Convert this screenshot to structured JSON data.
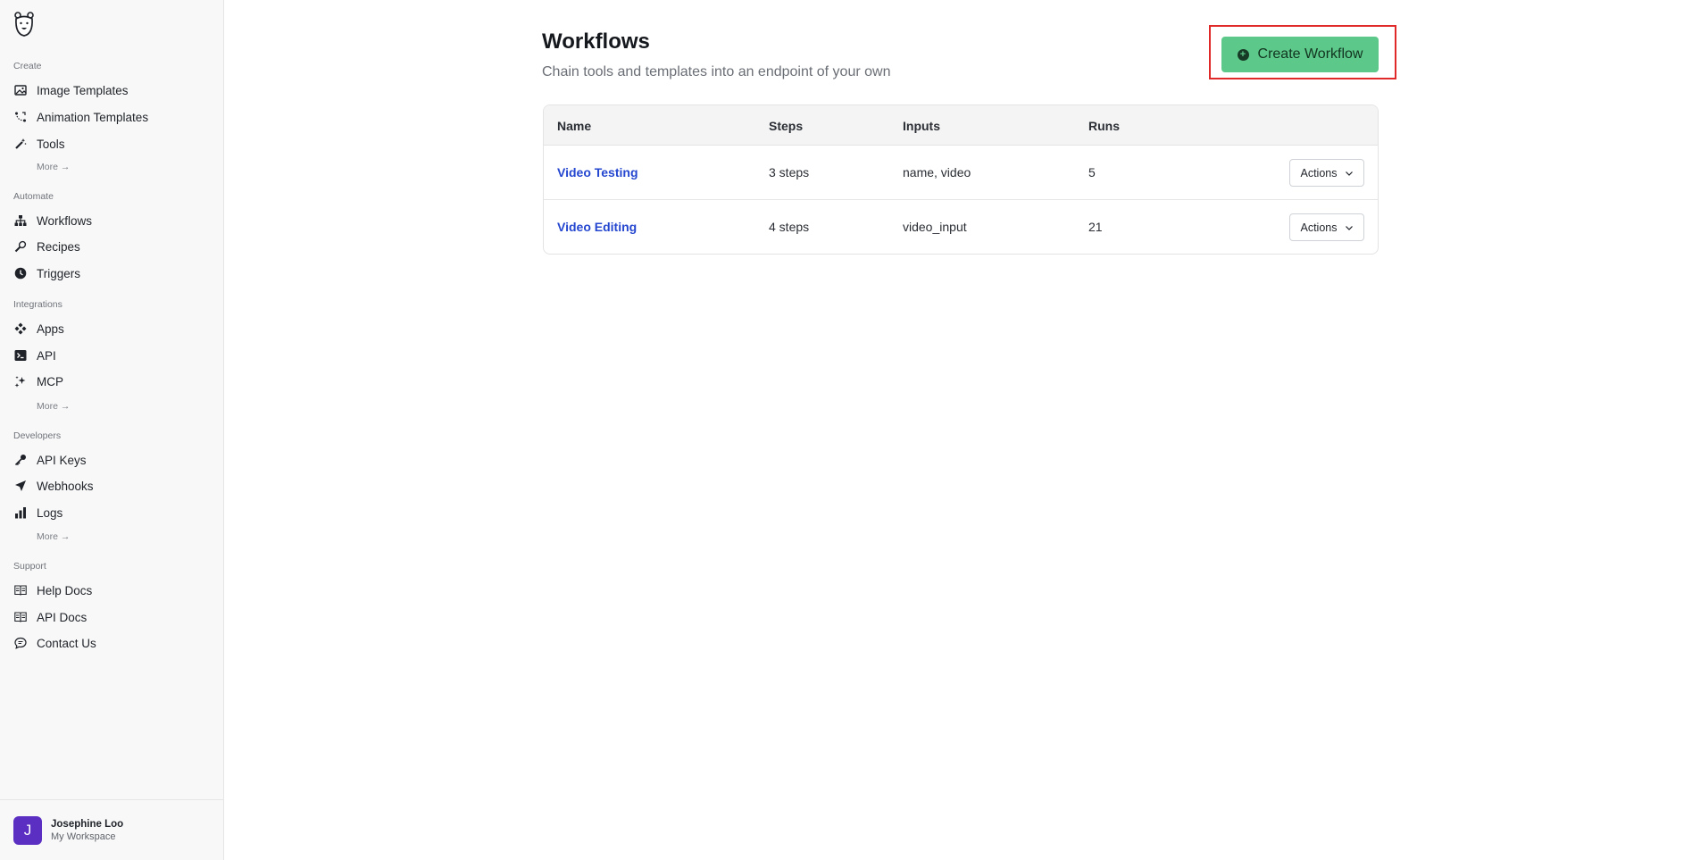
{
  "sidebar": {
    "sections": {
      "create": "Create",
      "automate": "Automate",
      "integrations": "Integrations",
      "developers": "Developers",
      "support": "Support"
    },
    "items": {
      "image_templates": "Image Templates",
      "animation_templates": "Animation Templates",
      "tools": "Tools",
      "workflows": "Workflows",
      "recipes": "Recipes",
      "triggers": "Triggers",
      "apps": "Apps",
      "api": "API",
      "mcp": "MCP",
      "api_keys": "API Keys",
      "webhooks": "Webhooks",
      "logs": "Logs",
      "help_docs": "Help Docs",
      "api_docs": "API Docs",
      "contact_us": "Contact Us"
    },
    "more_label": "More →",
    "user": {
      "initial": "J",
      "name": "Josephine Loo",
      "workspace": "My Workspace"
    }
  },
  "main": {
    "title": "Workflows",
    "subtitle": "Chain tools and templates into an endpoint of your own",
    "create_button": "Create Workflow",
    "table": {
      "headers": {
        "name": "Name",
        "steps": "Steps",
        "inputs": "Inputs",
        "runs": "Runs"
      },
      "rows": [
        {
          "name": "Video Testing",
          "steps": "3 steps",
          "inputs": "name, video",
          "runs": "5",
          "actions": "Actions"
        },
        {
          "name": "Video Editing",
          "steps": "4 steps",
          "inputs": "video_input",
          "runs": "21",
          "actions": "Actions"
        }
      ]
    }
  },
  "colors": {
    "accent_green": "#5cc98a",
    "link_blue": "#2547d0",
    "highlight_red": "#e02a2a",
    "avatar_purple": "#5b2fc2"
  }
}
